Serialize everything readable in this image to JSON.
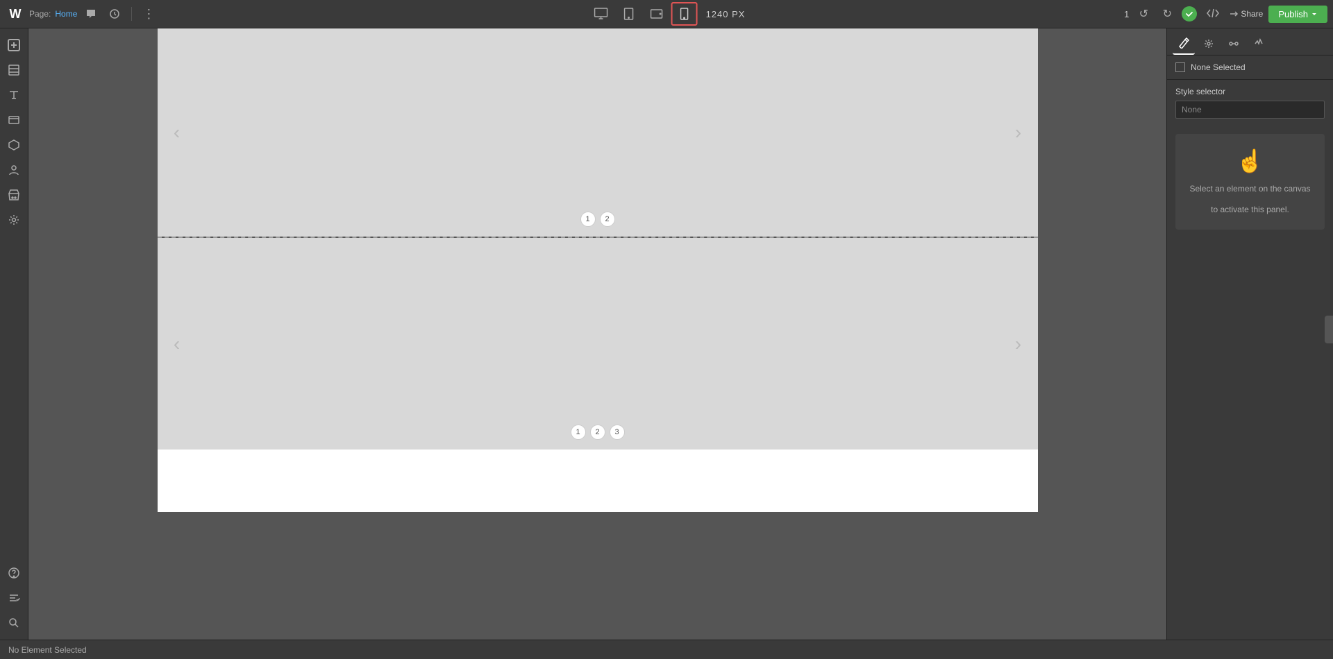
{
  "app": {
    "logo": "W",
    "page_label": "Page:",
    "page_name": "Home"
  },
  "topbar": {
    "comment_icon": "💬",
    "history_icon": "↺",
    "more_icon": "⋮",
    "view_desktop_label": "desktop",
    "view_tablet_label": "tablet",
    "view_tablet2_label": "tablet2",
    "view_mobile_label": "mobile",
    "px_display": "1240 PX",
    "page_num": "1",
    "undo_label": "↺",
    "redo_label": "↻",
    "share_label": "Share",
    "publish_label": "Publish"
  },
  "sidebar": {
    "items": [
      {
        "name": "add-section",
        "icon": "+",
        "label": "Add"
      },
      {
        "name": "layers",
        "icon": "⊞",
        "label": "Layers"
      },
      {
        "name": "text",
        "icon": "≡",
        "label": "Text"
      },
      {
        "name": "media",
        "icon": "▭",
        "label": "Media"
      },
      {
        "name": "components",
        "icon": "⬡",
        "label": "Components"
      },
      {
        "name": "people",
        "icon": "👤",
        "label": "People"
      },
      {
        "name": "store",
        "icon": "🏪",
        "label": "Store"
      },
      {
        "name": "settings",
        "icon": "⚙",
        "label": "Settings"
      }
    ],
    "bottom_items": [
      {
        "name": "help",
        "icon": "?",
        "label": "Help"
      },
      {
        "name": "tasks",
        "icon": "✓",
        "label": "Tasks"
      },
      {
        "name": "search",
        "icon": "🔍",
        "label": "Search"
      }
    ]
  },
  "canvas": {
    "section1": {
      "slide_dots": [
        "1",
        "2"
      ],
      "has_nav": true
    },
    "section2": {
      "slide_dots": [
        "1",
        "2",
        "3"
      ],
      "has_nav": true
    }
  },
  "right_panel": {
    "tabs": [
      {
        "name": "style",
        "icon": "✏",
        "active": true
      },
      {
        "name": "settings",
        "icon": "⚙",
        "active": false
      },
      {
        "name": "interaction",
        "icon": "⋯",
        "active": false
      },
      {
        "name": "animate",
        "icon": "⚡",
        "active": false
      }
    ],
    "none_selected_label": "None Selected",
    "style_selector": {
      "label": "Style selector",
      "value": "None"
    },
    "hint": {
      "icon": "☝",
      "line1": "Select an element on the canvas",
      "line2": "to activate this panel."
    }
  },
  "statusbar": {
    "text": "No Element Selected"
  }
}
